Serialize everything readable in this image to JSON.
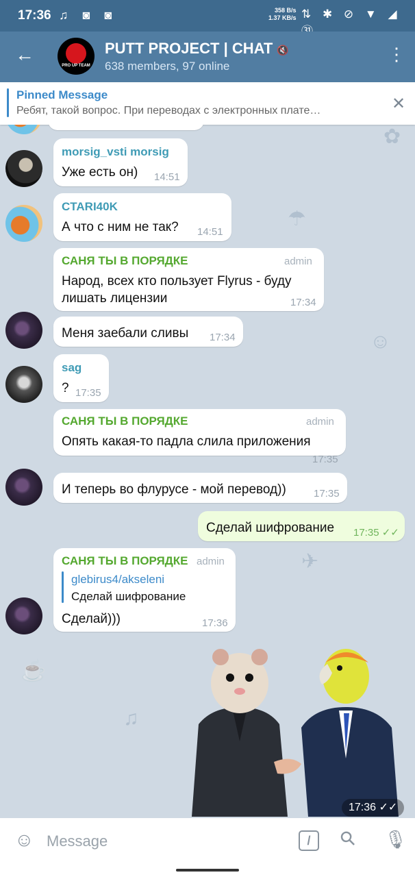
{
  "statusbar": {
    "time": "17:36",
    "left_icons": "♫ ◙ ◙",
    "net_speed_up": "358 B/s",
    "net_speed_down": "1.37 KB/s",
    "right_icons": "⇅ ✱ ⊘ ▼ ◢ ㉛"
  },
  "header": {
    "back_icon": "←",
    "avatar_label": "PRO UP TEAM",
    "title": "PUTT PROJECT | CHAT",
    "mute_icon": "🔇",
    "subtitle": "638 members, 97 online",
    "menu_icon": "⋮"
  },
  "pinned": {
    "label": "Pinned Message",
    "text": "Ребят, такой вопрос. При переводах с электронных плате…",
    "close_icon": "✕"
  },
  "messages": [
    {
      "sender": "morsig_vsti morsig",
      "text": "Уже есть он)",
      "time": "14:51"
    },
    {
      "sender": "CTARI40K",
      "text": "А что с ним не так?",
      "time": "14:51"
    },
    {
      "sender": "САНЯ ТЫ В ПОРЯДКЕ",
      "badge": "admin",
      "text_line1": "Народ, всех кто пользует Flyrus - буду",
      "text_line2": "лишать лицензии",
      "time": "17:34"
    },
    {
      "text": "Меня заебали сливы",
      "time": "17:34"
    },
    {
      "sender": "sag",
      "text": "?",
      "time": "17:35"
    },
    {
      "sender": "САНЯ ТЫ В ПОРЯДКЕ",
      "badge": "admin",
      "text": "Опять какая-то падла слила приложения",
      "time": "17:35"
    },
    {
      "text": "И теперь во флурусе - мой перевод))",
      "time": "17:35"
    },
    {
      "text": "Сделай шифрование",
      "time": "17:35",
      "check": "✓✓"
    },
    {
      "sender": "САНЯ ТЫ В ПОРЯДКЕ",
      "badge": "admin",
      "reply_name": "glebirus4/akseleni",
      "reply_text": "Сделай шифрование",
      "text": "Сделай)))",
      "time": "17:36"
    }
  ],
  "sticker": {
    "time": "17:36",
    "check": "✓✓"
  },
  "composer": {
    "placeholder": "Message",
    "smile_icon": "☺",
    "command_icon": "/",
    "attach_icon": "⚲",
    "mic_icon": "🎙"
  },
  "colors": {
    "header": "#517da2",
    "statusbar": "#3e6a8e",
    "chat_bg": "#cfd9e3",
    "admin_name": "#54a82f",
    "link": "#3c8ac9",
    "out_bubble": "#effdde"
  }
}
